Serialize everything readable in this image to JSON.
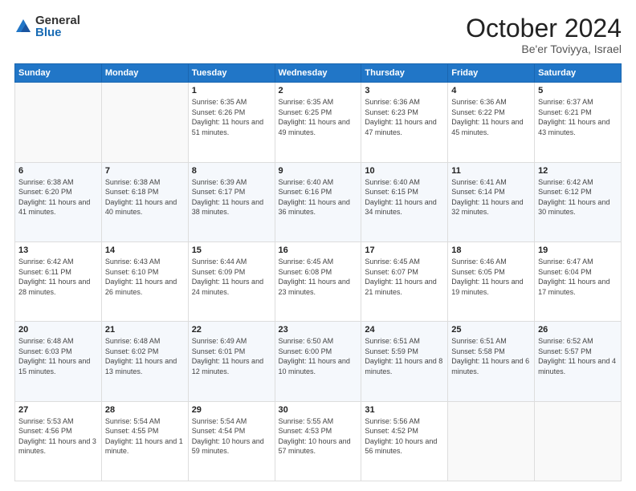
{
  "logo": {
    "general": "General",
    "blue": "Blue"
  },
  "header": {
    "month": "October 2024",
    "location": "Be'er Toviyya, Israel"
  },
  "days_of_week": [
    "Sunday",
    "Monday",
    "Tuesday",
    "Wednesday",
    "Thursday",
    "Friday",
    "Saturday"
  ],
  "weeks": [
    [
      null,
      null,
      {
        "day": 1,
        "sunrise": "6:35 AM",
        "sunset": "6:26 PM",
        "daylight": "11 hours and 51 minutes."
      },
      {
        "day": 2,
        "sunrise": "6:35 AM",
        "sunset": "6:25 PM",
        "daylight": "11 hours and 49 minutes."
      },
      {
        "day": 3,
        "sunrise": "6:36 AM",
        "sunset": "6:23 PM",
        "daylight": "11 hours and 47 minutes."
      },
      {
        "day": 4,
        "sunrise": "6:36 AM",
        "sunset": "6:22 PM",
        "daylight": "11 hours and 45 minutes."
      },
      {
        "day": 5,
        "sunrise": "6:37 AM",
        "sunset": "6:21 PM",
        "daylight": "11 hours and 43 minutes."
      }
    ],
    [
      {
        "day": 6,
        "sunrise": "6:38 AM",
        "sunset": "6:20 PM",
        "daylight": "11 hours and 41 minutes."
      },
      {
        "day": 7,
        "sunrise": "6:38 AM",
        "sunset": "6:18 PM",
        "daylight": "11 hours and 40 minutes."
      },
      {
        "day": 8,
        "sunrise": "6:39 AM",
        "sunset": "6:17 PM",
        "daylight": "11 hours and 38 minutes."
      },
      {
        "day": 9,
        "sunrise": "6:40 AM",
        "sunset": "6:16 PM",
        "daylight": "11 hours and 36 minutes."
      },
      {
        "day": 10,
        "sunrise": "6:40 AM",
        "sunset": "6:15 PM",
        "daylight": "11 hours and 34 minutes."
      },
      {
        "day": 11,
        "sunrise": "6:41 AM",
        "sunset": "6:14 PM",
        "daylight": "11 hours and 32 minutes."
      },
      {
        "day": 12,
        "sunrise": "6:42 AM",
        "sunset": "6:12 PM",
        "daylight": "11 hours and 30 minutes."
      }
    ],
    [
      {
        "day": 13,
        "sunrise": "6:42 AM",
        "sunset": "6:11 PM",
        "daylight": "11 hours and 28 minutes."
      },
      {
        "day": 14,
        "sunrise": "6:43 AM",
        "sunset": "6:10 PM",
        "daylight": "11 hours and 26 minutes."
      },
      {
        "day": 15,
        "sunrise": "6:44 AM",
        "sunset": "6:09 PM",
        "daylight": "11 hours and 24 minutes."
      },
      {
        "day": 16,
        "sunrise": "6:45 AM",
        "sunset": "6:08 PM",
        "daylight": "11 hours and 23 minutes."
      },
      {
        "day": 17,
        "sunrise": "6:45 AM",
        "sunset": "6:07 PM",
        "daylight": "11 hours and 21 minutes."
      },
      {
        "day": 18,
        "sunrise": "6:46 AM",
        "sunset": "6:05 PM",
        "daylight": "11 hours and 19 minutes."
      },
      {
        "day": 19,
        "sunrise": "6:47 AM",
        "sunset": "6:04 PM",
        "daylight": "11 hours and 17 minutes."
      }
    ],
    [
      {
        "day": 20,
        "sunrise": "6:48 AM",
        "sunset": "6:03 PM",
        "daylight": "11 hours and 15 minutes."
      },
      {
        "day": 21,
        "sunrise": "6:48 AM",
        "sunset": "6:02 PM",
        "daylight": "11 hours and 13 minutes."
      },
      {
        "day": 22,
        "sunrise": "6:49 AM",
        "sunset": "6:01 PM",
        "daylight": "11 hours and 12 minutes."
      },
      {
        "day": 23,
        "sunrise": "6:50 AM",
        "sunset": "6:00 PM",
        "daylight": "11 hours and 10 minutes."
      },
      {
        "day": 24,
        "sunrise": "6:51 AM",
        "sunset": "5:59 PM",
        "daylight": "11 hours and 8 minutes."
      },
      {
        "day": 25,
        "sunrise": "6:51 AM",
        "sunset": "5:58 PM",
        "daylight": "11 hours and 6 minutes."
      },
      {
        "day": 26,
        "sunrise": "6:52 AM",
        "sunset": "5:57 PM",
        "daylight": "11 hours and 4 minutes."
      }
    ],
    [
      {
        "day": 27,
        "sunrise": "5:53 AM",
        "sunset": "4:56 PM",
        "daylight": "11 hours and 3 minutes."
      },
      {
        "day": 28,
        "sunrise": "5:54 AM",
        "sunset": "4:55 PM",
        "daylight": "11 hours and 1 minute."
      },
      {
        "day": 29,
        "sunrise": "5:54 AM",
        "sunset": "4:54 PM",
        "daylight": "10 hours and 59 minutes."
      },
      {
        "day": 30,
        "sunrise": "5:55 AM",
        "sunset": "4:53 PM",
        "daylight": "10 hours and 57 minutes."
      },
      {
        "day": 31,
        "sunrise": "5:56 AM",
        "sunset": "4:52 PM",
        "daylight": "10 hours and 56 minutes."
      },
      null,
      null
    ]
  ]
}
